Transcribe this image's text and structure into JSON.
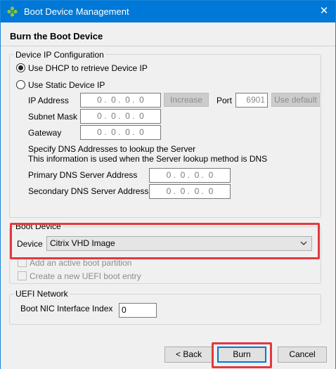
{
  "window": {
    "title": "Boot Device Management",
    "close_glyph": "✕"
  },
  "page": {
    "heading": "Burn the Boot Device"
  },
  "ip_config": {
    "legend": "Device IP Configuration",
    "dhcp_label": "Use DHCP to retrieve Device IP",
    "dhcp_selected": true,
    "static_label": "Use Static Device IP",
    "static_selected": false,
    "ip_label": "IP Address",
    "ip_value": "0 .  0 .  0 .  0",
    "increase_label": "Increase",
    "port_label": "Port",
    "port_value": "6901",
    "use_default_label": "Use default",
    "subnet_label": "Subnet Mask",
    "subnet_value": "0 .  0 .  0 .  0",
    "gateway_label": "Gateway",
    "gateway_value": "0 .  0 .  0 .  0",
    "dns_note_line1": "Specify DNS Addresses to lookup the Server",
    "dns_note_line2": "This information is used when the Server lookup method is DNS",
    "primary_dns_label": "Primary DNS Server Address",
    "primary_dns_value": "0 .  0 .  0 .  0",
    "secondary_dns_label": "Secondary DNS Server Address",
    "secondary_dns_value": "0 .  0 .  0 .  0"
  },
  "boot_device": {
    "legend": "Boot Device",
    "device_label": "Device",
    "device_value": "Citrix VHD Image",
    "add_partition_label": "Add an active boot partition",
    "create_uefi_label": "Create a new UEFI boot entry"
  },
  "uefi": {
    "legend": "UEFI Network",
    "nic_index_label": "Boot NIC Interface Index",
    "nic_index_value": "0"
  },
  "footer": {
    "back_label": "< Back",
    "burn_label": "Burn",
    "cancel_label": "Cancel"
  },
  "colors": {
    "titlebar": "#0078d7",
    "highlight": "#e0393e",
    "dialog_bg": "#f0f0f0"
  },
  "icons": [
    "app-icon",
    "close-icon",
    "chevron-down-icon"
  ]
}
